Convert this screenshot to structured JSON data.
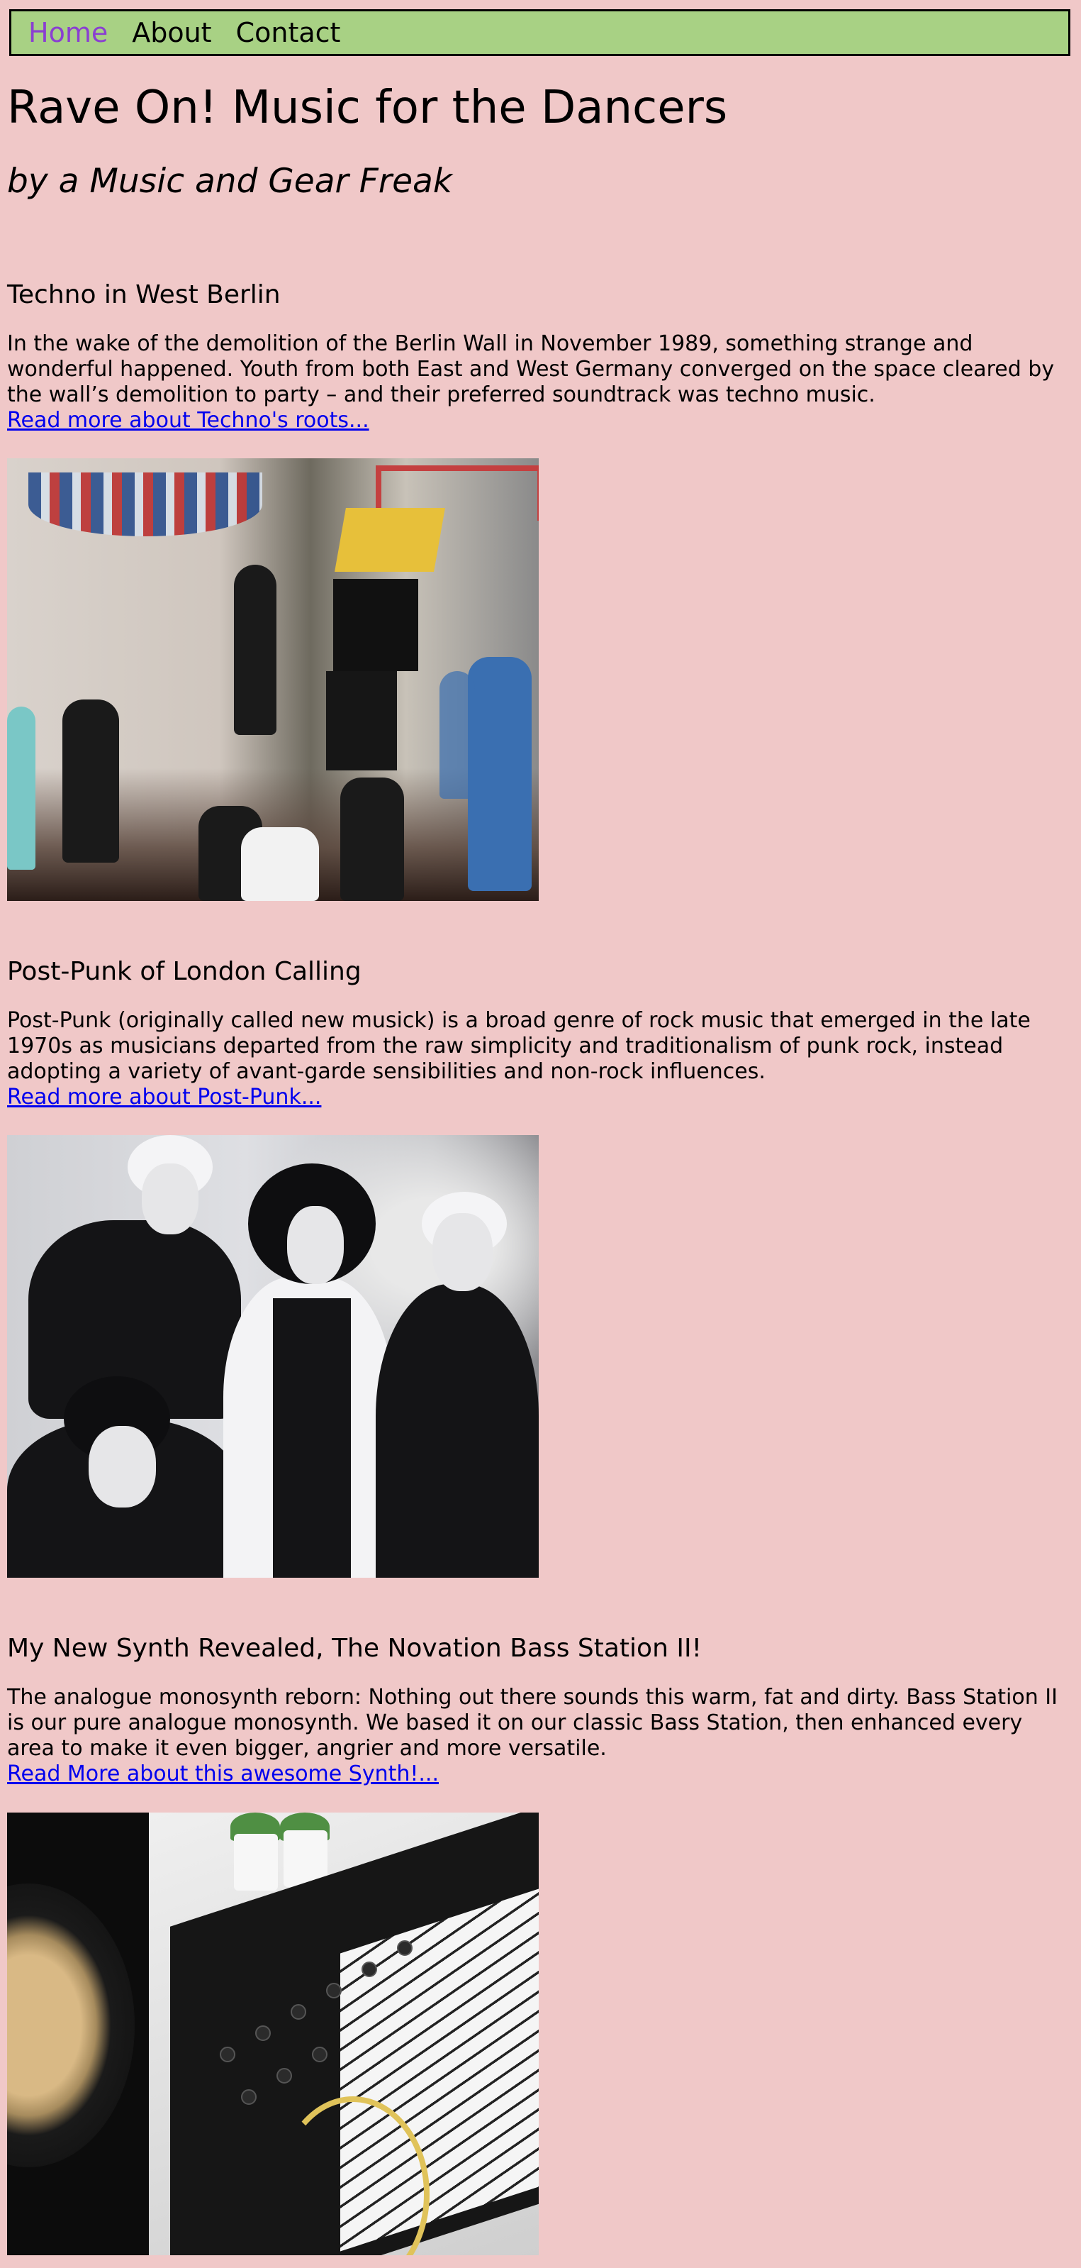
{
  "nav": {
    "items": [
      {
        "label": "Home",
        "active": true
      },
      {
        "label": "About",
        "active": false
      },
      {
        "label": "Contact",
        "active": false
      }
    ]
  },
  "header": {
    "title": "Rave On! Music for the Dancers",
    "subtitle": "by a Music and Gear Freak"
  },
  "articles": [
    {
      "heading": "Techno in West Berlin",
      "body": "In the wake of the demolition of the Berlin Wall in November 1989, something strange and wonderful happened. Youth from both East and West Germany converged on the space cleared by the wall’s demolition to party – and their preferred soundtrack was techno music.",
      "link": "Read more about Techno's roots..."
    },
    {
      "heading": "Post-Punk of London Calling",
      "body": "Post-Punk (originally called new musick) is a broad genre of rock music that emerged in the late 1970s as musicians departed from the raw simplicity and traditionalism of punk rock, instead adopting a variety of avant-garde sensibilities and non-rock influences.",
      "link": "Read more about Post-Punk..."
    },
    {
      "heading": "My New Synth Revealed, The Novation Bass Station II!",
      "body": "The analogue monosynth reborn: Nothing out there sounds this warm, fat and dirty. Bass Station II is our pure analogue monosynth. We based it on our classic Bass Station, then enhanced every area to make it even bigger, angrier and more versatile.",
      "link": "Read More about this awesome Synth!..."
    }
  ],
  "colors": {
    "page_background": "#f0c8c8",
    "nav_background": "#a8d184",
    "nav_active": "#8a3fd1",
    "link": "#0000ee"
  }
}
